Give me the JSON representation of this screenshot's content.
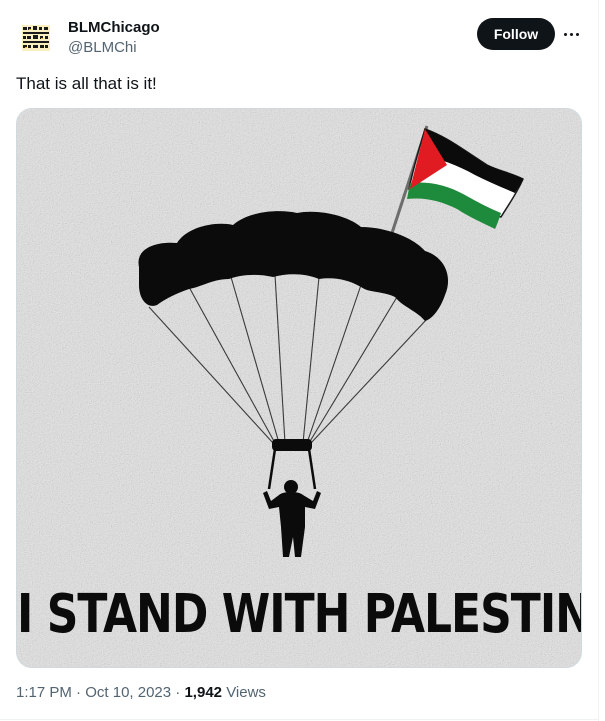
{
  "tweet": {
    "author": {
      "display_name": "BLMChicago",
      "handle": "@BLMChi",
      "avatar_icon": "blm-chicago-logo"
    },
    "follow_label": "Follow",
    "more_icon": "more-horizontal-icon",
    "text": "That is all that is it!",
    "media": {
      "caption": "I STAND WITH PALESTINE.",
      "flag_colors": {
        "red": "#e01b22",
        "black": "#0b0b0b",
        "white": "#ffffff",
        "green": "#1e8a3c"
      },
      "background": "#e4e4e4"
    },
    "meta": {
      "time": "1:17 PM",
      "separator": "·",
      "date": "Oct 10, 2023",
      "views_count": "1,942",
      "views_label": "Views"
    }
  },
  "colors": {
    "text_primary": "#0f1419",
    "text_secondary": "#536471",
    "border": "#cfd9de",
    "follow_bg": "#0f1419"
  }
}
